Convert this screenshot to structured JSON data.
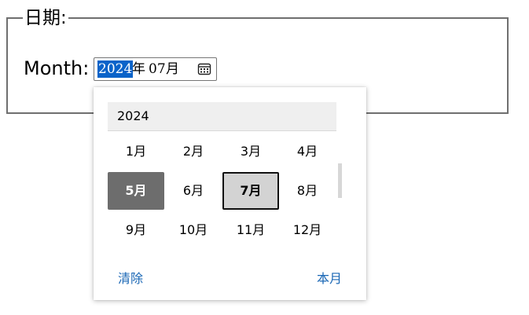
{
  "fieldset": {
    "legend": "日期:",
    "label": "Month:"
  },
  "month_input": {
    "year": "2024",
    "year_separator": "年",
    "month": "07",
    "month_suffix": "月",
    "icon": "calendar-icon"
  },
  "picker": {
    "year_header": "2024",
    "months": [
      "1月",
      "2月",
      "3月",
      "4月",
      "5月",
      "6月",
      "7月",
      "8月",
      "9月",
      "10月",
      "11月",
      "12月"
    ],
    "selected_month": "5月",
    "current_month": "7月",
    "clear_label": "清除",
    "this_month_label": "本月"
  },
  "colors": {
    "selection_highlight": "#0a63c9",
    "selected_cell": "#6d6d6d",
    "current_cell": "#d3d3d3",
    "link": "#1a67b5"
  }
}
